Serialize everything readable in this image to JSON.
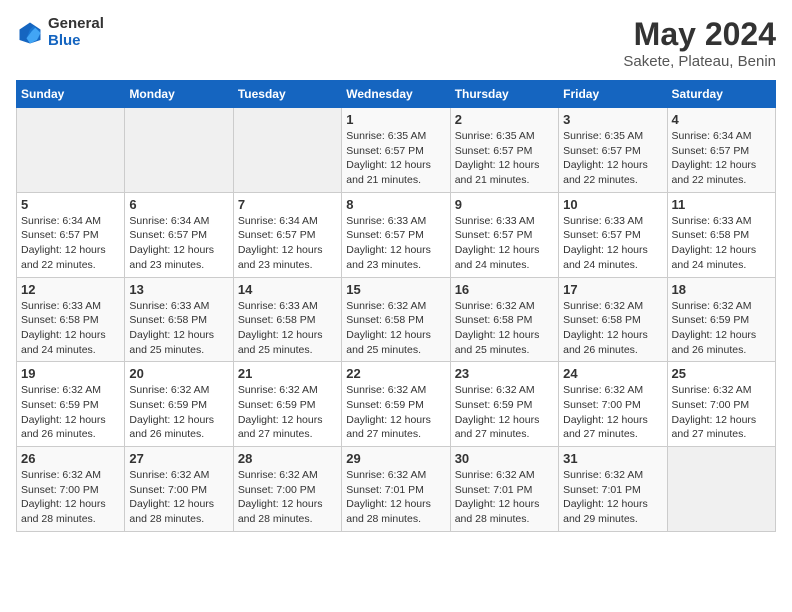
{
  "logo": {
    "general": "General",
    "blue": "Blue"
  },
  "title": "May 2024",
  "subtitle": "Sakete, Plateau, Benin",
  "headers": [
    "Sunday",
    "Monday",
    "Tuesday",
    "Wednesday",
    "Thursday",
    "Friday",
    "Saturday"
  ],
  "weeks": [
    [
      {
        "day": "",
        "info": ""
      },
      {
        "day": "",
        "info": ""
      },
      {
        "day": "",
        "info": ""
      },
      {
        "day": "1",
        "info": "Sunrise: 6:35 AM\nSunset: 6:57 PM\nDaylight: 12 hours\nand 21 minutes."
      },
      {
        "day": "2",
        "info": "Sunrise: 6:35 AM\nSunset: 6:57 PM\nDaylight: 12 hours\nand 21 minutes."
      },
      {
        "day": "3",
        "info": "Sunrise: 6:35 AM\nSunset: 6:57 PM\nDaylight: 12 hours\nand 22 minutes."
      },
      {
        "day": "4",
        "info": "Sunrise: 6:34 AM\nSunset: 6:57 PM\nDaylight: 12 hours\nand 22 minutes."
      }
    ],
    [
      {
        "day": "5",
        "info": "Sunrise: 6:34 AM\nSunset: 6:57 PM\nDaylight: 12 hours\nand 22 minutes."
      },
      {
        "day": "6",
        "info": "Sunrise: 6:34 AM\nSunset: 6:57 PM\nDaylight: 12 hours\nand 23 minutes."
      },
      {
        "day": "7",
        "info": "Sunrise: 6:34 AM\nSunset: 6:57 PM\nDaylight: 12 hours\nand 23 minutes."
      },
      {
        "day": "8",
        "info": "Sunrise: 6:33 AM\nSunset: 6:57 PM\nDaylight: 12 hours\nand 23 minutes."
      },
      {
        "day": "9",
        "info": "Sunrise: 6:33 AM\nSunset: 6:57 PM\nDaylight: 12 hours\nand 24 minutes."
      },
      {
        "day": "10",
        "info": "Sunrise: 6:33 AM\nSunset: 6:57 PM\nDaylight: 12 hours\nand 24 minutes."
      },
      {
        "day": "11",
        "info": "Sunrise: 6:33 AM\nSunset: 6:58 PM\nDaylight: 12 hours\nand 24 minutes."
      }
    ],
    [
      {
        "day": "12",
        "info": "Sunrise: 6:33 AM\nSunset: 6:58 PM\nDaylight: 12 hours\nand 24 minutes."
      },
      {
        "day": "13",
        "info": "Sunrise: 6:33 AM\nSunset: 6:58 PM\nDaylight: 12 hours\nand 25 minutes."
      },
      {
        "day": "14",
        "info": "Sunrise: 6:33 AM\nSunset: 6:58 PM\nDaylight: 12 hours\nand 25 minutes."
      },
      {
        "day": "15",
        "info": "Sunrise: 6:32 AM\nSunset: 6:58 PM\nDaylight: 12 hours\nand 25 minutes."
      },
      {
        "day": "16",
        "info": "Sunrise: 6:32 AM\nSunset: 6:58 PM\nDaylight: 12 hours\nand 25 minutes."
      },
      {
        "day": "17",
        "info": "Sunrise: 6:32 AM\nSunset: 6:58 PM\nDaylight: 12 hours\nand 26 minutes."
      },
      {
        "day": "18",
        "info": "Sunrise: 6:32 AM\nSunset: 6:59 PM\nDaylight: 12 hours\nand 26 minutes."
      }
    ],
    [
      {
        "day": "19",
        "info": "Sunrise: 6:32 AM\nSunset: 6:59 PM\nDaylight: 12 hours\nand 26 minutes."
      },
      {
        "day": "20",
        "info": "Sunrise: 6:32 AM\nSunset: 6:59 PM\nDaylight: 12 hours\nand 26 minutes."
      },
      {
        "day": "21",
        "info": "Sunrise: 6:32 AM\nSunset: 6:59 PM\nDaylight: 12 hours\nand 27 minutes."
      },
      {
        "day": "22",
        "info": "Sunrise: 6:32 AM\nSunset: 6:59 PM\nDaylight: 12 hours\nand 27 minutes."
      },
      {
        "day": "23",
        "info": "Sunrise: 6:32 AM\nSunset: 6:59 PM\nDaylight: 12 hours\nand 27 minutes."
      },
      {
        "day": "24",
        "info": "Sunrise: 6:32 AM\nSunset: 7:00 PM\nDaylight: 12 hours\nand 27 minutes."
      },
      {
        "day": "25",
        "info": "Sunrise: 6:32 AM\nSunset: 7:00 PM\nDaylight: 12 hours\nand 27 minutes."
      }
    ],
    [
      {
        "day": "26",
        "info": "Sunrise: 6:32 AM\nSunset: 7:00 PM\nDaylight: 12 hours\nand 28 minutes."
      },
      {
        "day": "27",
        "info": "Sunrise: 6:32 AM\nSunset: 7:00 PM\nDaylight: 12 hours\nand 28 minutes."
      },
      {
        "day": "28",
        "info": "Sunrise: 6:32 AM\nSunset: 7:00 PM\nDaylight: 12 hours\nand 28 minutes."
      },
      {
        "day": "29",
        "info": "Sunrise: 6:32 AM\nSunset: 7:01 PM\nDaylight: 12 hours\nand 28 minutes."
      },
      {
        "day": "30",
        "info": "Sunrise: 6:32 AM\nSunset: 7:01 PM\nDaylight: 12 hours\nand 28 minutes."
      },
      {
        "day": "31",
        "info": "Sunrise: 6:32 AM\nSunset: 7:01 PM\nDaylight: 12 hours\nand 29 minutes."
      },
      {
        "day": "",
        "info": ""
      }
    ]
  ]
}
